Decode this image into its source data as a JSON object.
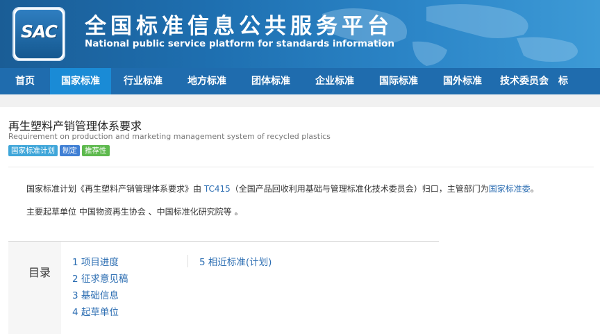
{
  "header": {
    "logo_text": "SAC",
    "site_title_cn": "全国标准信息公共服务平台",
    "site_title_en": "National public service platform  for standards information"
  },
  "nav": {
    "items": [
      {
        "label": "首页",
        "active": false
      },
      {
        "label": "国家标准",
        "active": true
      },
      {
        "label": "行业标准",
        "active": false
      },
      {
        "label": "地方标准",
        "active": false
      },
      {
        "label": "团体标准",
        "active": false
      },
      {
        "label": "企业标准",
        "active": false
      },
      {
        "label": "国际标准",
        "active": false
      },
      {
        "label": "国外标准",
        "active": false
      },
      {
        "label": "技术委员会",
        "active": false
      },
      {
        "label": "标",
        "active": false
      }
    ]
  },
  "standard": {
    "title_cn": "再生塑料产销管理体系要求",
    "title_en": "Requirement on production and marketing management system of recycled plastics",
    "badges": [
      "国家标准计划",
      "制定",
      "推荐性"
    ]
  },
  "summary": {
    "line1_a": "国家标准计划《再生塑料产销管理体系要求》由 ",
    "tc_link": "TC415",
    "line1_b": "（全国产品回收利用基础与管理标准化技术委员会）归口，主管部门为",
    "dept_link": "国家标准委",
    "line1_c": "。",
    "line2": "主要起草单位 中国物资再生协会 、中国标准化研究院等 。"
  },
  "toc": {
    "label": "目录",
    "col1": [
      "1 项目进度",
      "2 征求意见稿",
      "3 基础信息",
      "4 起草单位"
    ],
    "col2": [
      "5 相近标准(计划)"
    ]
  },
  "colors": {
    "banner": "#1e6fb0",
    "nav": "#1f6cae",
    "nav_active": "#1a8bd6",
    "link": "#2b6db2",
    "badge_plan": "#3fa6d9",
    "badge_make": "#3f7fd4",
    "badge_recommend": "#5db94d"
  }
}
